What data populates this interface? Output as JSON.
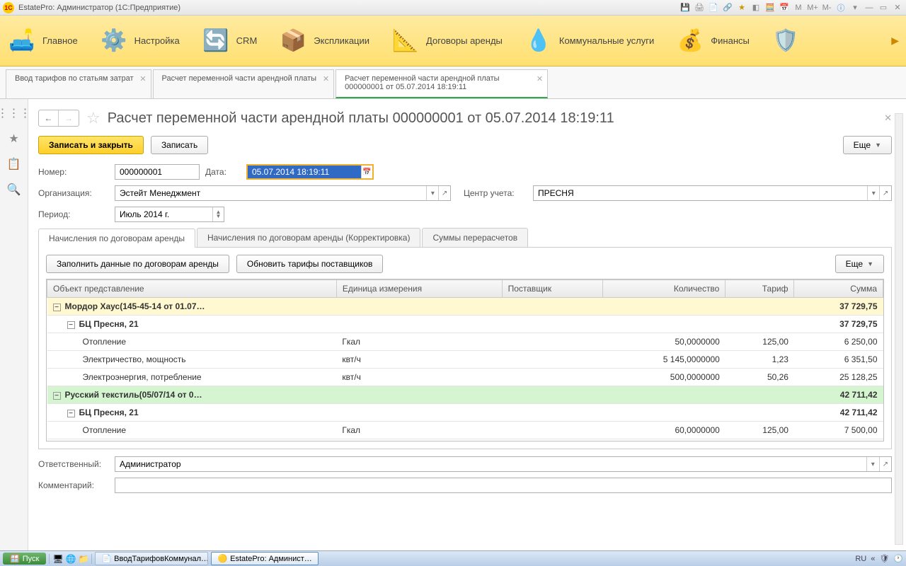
{
  "window": {
    "title": "EstatePro: Администратор  (1С:Предприятие)"
  },
  "topbar_icons": {
    "m": "M",
    "mplus": "M+",
    "mminus": "M-"
  },
  "maintoolbar": [
    {
      "label": "Главное",
      "icon": "🛋️"
    },
    {
      "label": "Настройка",
      "icon": "⚙️"
    },
    {
      "label": "CRM",
      "icon": "🔄"
    },
    {
      "label": "Экспликации",
      "icon": "📦"
    },
    {
      "label": "Договоры аренды",
      "icon": "📐"
    },
    {
      "label": "Коммунальные услуги",
      "icon": "💧"
    },
    {
      "label": "Финансы",
      "icon": "💰"
    }
  ],
  "tabs": [
    {
      "label": "Ввод тарифов по статьям затрат"
    },
    {
      "label": "Расчет переменной части арендной платы"
    },
    {
      "label": "Расчет переменной части арендной платы 000000001 от 05.07.2014 18:19:11",
      "active": true
    }
  ],
  "page": {
    "title": "Расчет переменной части арендной платы 000000001 от 05.07.2014 18:19:11",
    "save_close": "Записать и закрыть",
    "save": "Записать",
    "more": "Еще"
  },
  "form": {
    "number_label": "Номер:",
    "number": "000000001",
    "date_label": "Дата:",
    "date": "05.07.2014 18:19:11",
    "org_label": "Организация:",
    "org": "Эстейт Менеджмент",
    "center_label": "Центр учета:",
    "center": "ПРЕСНЯ",
    "period_label": "Период:",
    "period": "Июль 2014 г.",
    "resp_label": "Ответственный:",
    "resp": "Администратор",
    "comment_label": "Комментарий:"
  },
  "innertabs": [
    {
      "label": "Начисления по договорам аренды",
      "active": true
    },
    {
      "label": "Начисления по договорам аренды (Корректировка)"
    },
    {
      "label": "Суммы перерасчетов"
    }
  ],
  "panel": {
    "fill": "Заполнить данные по договорам аренды",
    "update": "Обновить тарифы поставщиков",
    "more": "Еще"
  },
  "grid": {
    "columns": [
      "Объект представление",
      "Единица измерения",
      "Поставщик",
      "Количество",
      "Тариф",
      "Сумма"
    ],
    "rows": [
      {
        "type": "g1",
        "c0": "Мордор Хаус(145-45-14 от 01.07…",
        "sum": "37 729,75"
      },
      {
        "type": "g2",
        "c0": "БЦ Пресня, 21",
        "sum": "37 729,75"
      },
      {
        "type": "d",
        "c0": "Отопление",
        "c1": "Гкал",
        "qty": "50,0000000",
        "tar": "125,00",
        "sum": "6 250,00"
      },
      {
        "type": "d",
        "c0": "Электричество, мощность",
        "c1": "квт/ч",
        "qty": "5 145,0000000",
        "tar": "1,23",
        "sum": "6 351,50"
      },
      {
        "type": "d",
        "c0": "Электроэнергия, потребление",
        "c1": "квт/ч",
        "qty": "500,0000000",
        "tar": "50,26",
        "sum": "25 128,25"
      },
      {
        "type": "g3",
        "c0": "Русский текстиль(05/07/14 от 0…",
        "sum": "42 711,42"
      },
      {
        "type": "g2",
        "c0": "БЦ Пресня, 21",
        "sum": "42 711,42"
      },
      {
        "type": "d",
        "c0": "Отопление",
        "c1": "Гкал",
        "qty": "60,0000000",
        "tar": "125,00",
        "sum": "7 500,00"
      }
    ]
  },
  "taskbar": {
    "start": "Пуск",
    "items": [
      {
        "label": "ВводТарифовКоммунал…"
      },
      {
        "label": "EstatePro: Админист…",
        "active": true
      }
    ],
    "lang": "RU"
  }
}
